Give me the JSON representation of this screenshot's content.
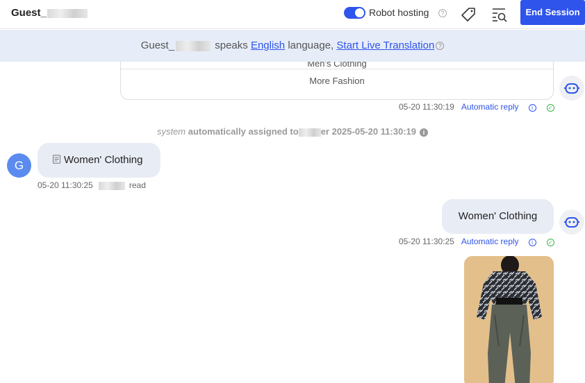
{
  "header": {
    "guest_name": "Guest_",
    "robot_hosting_label": "Robot hosting",
    "robot_hosting_enabled": true,
    "end_session_label": "End Session",
    "help_glyph": "?"
  },
  "banner": {
    "prefix": "Guest_",
    "speaks_text": "speaks",
    "language_link": "English",
    "language_suffix": "language,",
    "translation_link": "Start Live Translation",
    "help_glyph": "?"
  },
  "messages": {
    "options": [
      "Men's Clothing",
      "More Fashion"
    ],
    "reply1": {
      "time": "05-20 11:30:19",
      "status": "Automatic reply"
    },
    "system": {
      "actor": "system",
      "text": "automatically assigned to",
      "suffix": "er 2025-05-20 11:30:19"
    },
    "guest_message": {
      "avatar_letter": "G",
      "text": "Women' Clothing",
      "time": "05-20 11:30:25",
      "status": "read"
    },
    "bot_message": {
      "text": "Women' Clothing",
      "time": "05-20 11:30:25",
      "status": "Automatic reply"
    }
  },
  "icons": {
    "info": "i",
    "check": "✓"
  },
  "colors": {
    "accent": "#2f54eb",
    "banner_bg": "#e6edf8",
    "bubble_bg": "#e8ecf5",
    "avatar": "#5b8bef",
    "success": "#3bb34a"
  }
}
